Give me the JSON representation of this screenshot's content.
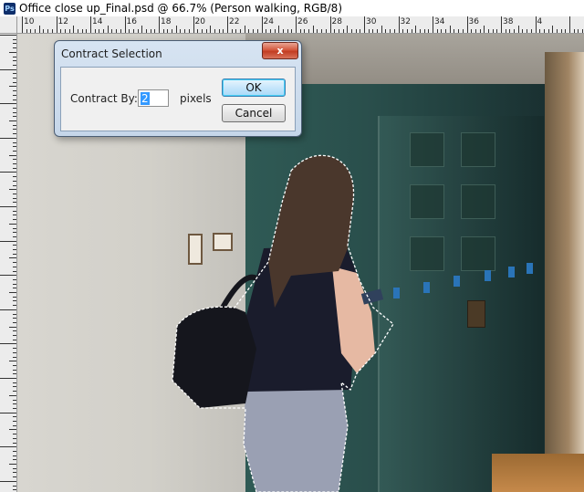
{
  "document": {
    "app_icon": "photoshop-icon",
    "app_icon_text": "Ps",
    "title": "Office close up_Final.psd @ 66.7% (Person walking, RGB/8)"
  },
  "rulers": {
    "top_labels": [
      "10",
      "12",
      "14",
      "16",
      "18",
      "20",
      "22",
      "24",
      "26",
      "28",
      "30",
      "32",
      "34",
      "36",
      "38",
      "4"
    ]
  },
  "dialog": {
    "title": "Contract Selection",
    "close_label": "x",
    "contract_label": "Contract By:",
    "contract_value": "2",
    "unit_label": "pixels",
    "ok_label": "OK",
    "cancel_label": "Cancel"
  },
  "colors": {
    "selection_marquee": "#ffffff",
    "ok_button_border": "#3c7fb1",
    "close_button": "#c23d22",
    "input_highlight": "#3399ff"
  }
}
